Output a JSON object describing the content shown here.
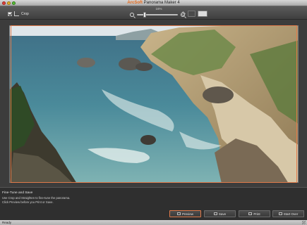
{
  "window": {
    "title_brand": "ArcSoft",
    "title_app": "Panorama Maker 4"
  },
  "toolbar": {
    "crop_label": "Crop",
    "crop_checked": true,
    "zoom_label": "16%"
  },
  "info": {
    "title": "Fine-Tune and Save",
    "line1": "Use Crop and Straighten to fine-tune the panorama.",
    "line2": "Click Preview before you Print or Save."
  },
  "buttons": {
    "preview": "Preview",
    "save": "Save",
    "print": "Print",
    "start_over": "Start Over"
  },
  "status": {
    "text": "Ready"
  },
  "icons": {
    "close": "close-icon",
    "minimize": "minimize-icon",
    "zoom": "zoom-window-icon",
    "crop": "crop-icon",
    "zoom_out": "zoom-out-icon",
    "zoom_in": "zoom-in-icon",
    "fit": "fit-window-icon",
    "view": "view-mode-icon"
  },
  "colors": {
    "accent": "#e07a4a",
    "brand": "#e86a1a"
  }
}
